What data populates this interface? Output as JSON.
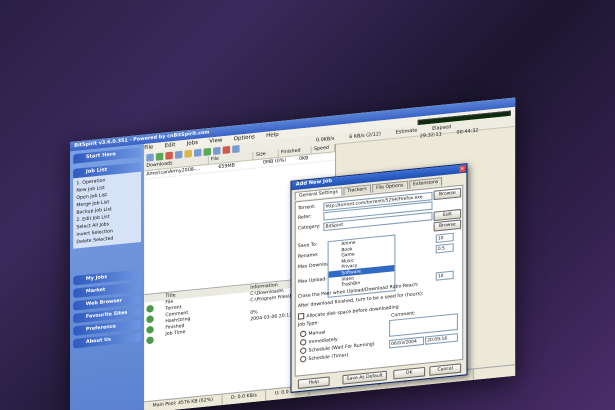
{
  "window": {
    "title": "BitSpirit v3.6.0.351 - Powered by cnBitSpirit.com"
  },
  "menu": [
    "File",
    "Edit",
    "Jobs",
    "View",
    "Options",
    "Help"
  ],
  "speeds": {
    "dl": "0.0KB/s",
    "ul": "6 KB/s (2/12)",
    "estimate": "Estimate",
    "elapsed": "Elapsed",
    "est_val": "29:32:11",
    "el_val": "00:44:32"
  },
  "sidebar": {
    "start_here": "Start Here",
    "job_list": "Job List",
    "items": [
      "1. Operation",
      "New Job List",
      "Open Job List",
      "Merge Job List",
      "Backup Job List",
      "2. Edit Job List",
      "Select All Jobs",
      "Invert Selection",
      "Delete Selected"
    ],
    "my_jobs": "My Jobs",
    "market": "Market",
    "web_browser": "Web Browser",
    "favourite_sites": "Favourite Sites",
    "preference": "Preference",
    "about_us": "About Us"
  },
  "list": {
    "headers": [
      "Downloads",
      "File",
      "Size",
      "Finished",
      "Speed"
    ],
    "row": [
      "AmericanArmy2008-...",
      "659MB",
      "0MB (0%)",
      "0KB"
    ]
  },
  "details": {
    "headers": [
      "Title",
      "Information"
    ],
    "rows": [
      [
        "File",
        "C:\\Downloads\\"
      ],
      [
        "Torrent",
        "C:\\Program Files\\BitSpirit\\"
      ],
      [
        "Comment",
        ""
      ],
      [
        "Hashstring",
        "0%"
      ],
      [
        "Finished",
        "2004-03-06 20:11:39"
      ],
      [
        "Job Time",
        ""
      ]
    ]
  },
  "status": [
    "Main Pool: 4576 KB (62%)",
    "D: 0.0 KB/s",
    "U: 0.0 KB/s",
    "1 Running (1 Downloading, 0 Seeding), 0 Waiting, 0 Scheduled"
  ],
  "dialog": {
    "title": "Add New Job",
    "tabs": [
      "General Settings",
      "Trackers",
      "File Options",
      "Extensions"
    ],
    "torrent_label": "Torrent:",
    "torrent_value": "http://torrent.com/torrents/5254/Firefox.exe",
    "browse": "Browse",
    "refer_label": "Refer:",
    "category_label": "Category:",
    "category_value": "BitSpirit",
    "edit": "Edit",
    "browse2": "Browse",
    "save_to_label": "Save To:",
    "rename_label": "Rename:",
    "max_down_label": "Max Download:",
    "max_up_label": "Max Upload:",
    "tree": [
      "Anime",
      "Book",
      "Game",
      "Music",
      "Privacy",
      "Software",
      "Video",
      "TrashBin"
    ],
    "tree_selected": "Software",
    "close_peer": "Close the Peer when Upload/Download Ratio Reach:",
    "after_finished": "After download finished, turn to be a seed for (hours):",
    "allocate": "Allocate disk space before downloading",
    "job_type": "Job Type:",
    "comment": "Comment:",
    "types": [
      "Manual",
      "Immediately",
      "Schedule (Wait For Running)",
      "Schedule (Timer)"
    ],
    "date": "06/03/2004",
    "time": "20:09:16",
    "spin1": "10",
    "spin2": "0.5",
    "spin3": "10",
    "help": "Help",
    "save_default": "Save As Default",
    "ok": "OK",
    "cancel": "Cancel"
  }
}
